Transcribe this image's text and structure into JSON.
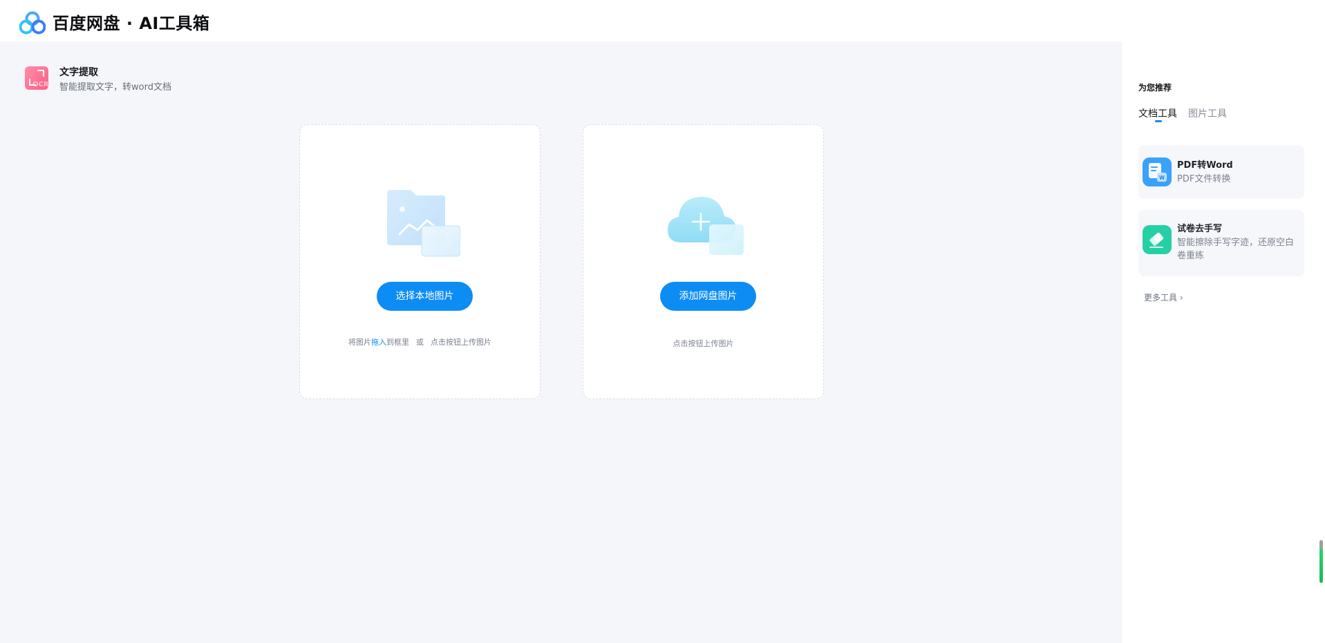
{
  "header": {
    "title": "百度网盘 · AI工具箱",
    "logo_icon": "baidu-netdisk-logo"
  },
  "tool": {
    "name": "文字提取",
    "description": "智能提取文字，转word文档",
    "icon": "ocr-icon",
    "icon_text": "OCR"
  },
  "upload_local": {
    "button_label": "选择本地图片",
    "hint_before": "将图片",
    "hint_accent": "拖入",
    "hint_after": "到框里",
    "hint_or": "或",
    "hint_click": "点击按钮上传图片",
    "icon": "folder-image-icon"
  },
  "upload_cloud": {
    "button_label": "添加网盘图片",
    "hint": "点击按钮上传图片",
    "icon": "cloud-add-icon"
  },
  "sidebar": {
    "title": "为您推荐",
    "tabs": [
      {
        "label": "文档工具",
        "active": true
      },
      {
        "label": "图片工具",
        "active": false
      }
    ],
    "items": [
      {
        "name": "PDF转Word",
        "description": "PDF文件转换",
        "icon": "pdf-to-word-icon"
      },
      {
        "name": "试卷去手写",
        "description": "智能擦除手写字迹，还原空白卷重练",
        "icon": "eraser-icon"
      }
    ],
    "more_label": "更多工具",
    "more_icon": "chevron-right-icon"
  },
  "colors": {
    "accent": "#0d8cf4",
    "background": "#f5f6fa",
    "ocr_icon": "#ff6f91"
  }
}
